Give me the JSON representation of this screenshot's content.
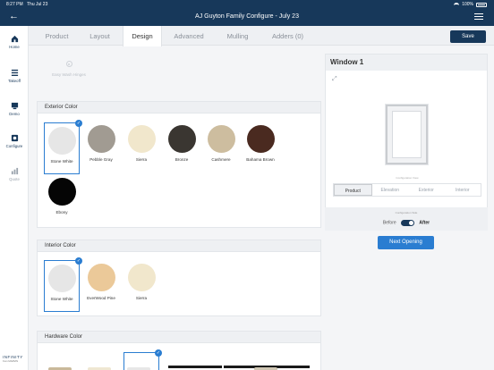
{
  "status": {
    "time": "8:27 PM",
    "date": "Thu Jul 23",
    "battery": "100%"
  },
  "header": {
    "title": "AJ Guyton Family Configure - July 23"
  },
  "nav": {
    "home": "Home",
    "takeoff": "Takeoff",
    "demo": "Demo",
    "configure": "Configure",
    "quote": "Quote",
    "brand": "INFINITY",
    "brand_sub": "from MARVIN"
  },
  "tabs": [
    "Product",
    "Layout",
    "Design",
    "Advanced",
    "Mulling",
    "Adders (0)"
  ],
  "active_tab": "Design",
  "save_label": "Save",
  "easy_wash_label": "Easy Wash Hinges",
  "exterior": {
    "title": "Exterior Color",
    "swatches": [
      {
        "label": "Stone White",
        "color": "#e6e6e6",
        "selected": true
      },
      {
        "label": "Pebble Gray",
        "color": "#a19b92"
      },
      {
        "label": "Sierra",
        "color": "#f1e7cc"
      },
      {
        "label": "Bronze",
        "color": "#3a3631"
      },
      {
        "label": "Cashmere",
        "color": "#cdbd9f"
      },
      {
        "label": "Bahama Brown",
        "color": "#4a2a20"
      },
      {
        "label": "Ebony",
        "color": "#050505"
      }
    ]
  },
  "interior": {
    "title": "Interior Color",
    "swatches": [
      {
        "label": "Stone White",
        "color": "#e6e6e6",
        "selected": true
      },
      {
        "label": "EverWood Pine",
        "color": "#ebc999"
      },
      {
        "label": "Sierra",
        "color": "#f1e7cc"
      }
    ]
  },
  "hardware": {
    "title": "Hardware Color"
  },
  "window_panel": {
    "title": "Window 1",
    "configuration_view_label": "Configuration View",
    "view_tabs": [
      "Product",
      "Elevation",
      "Exterior",
      "Interior"
    ],
    "active_view": "Product",
    "configuration_side_label": "Configuration Side",
    "before_label": "Before",
    "after_label": "After",
    "toggle_value": "After"
  },
  "next_button": "Next Opening",
  "check_glyph": "✓"
}
